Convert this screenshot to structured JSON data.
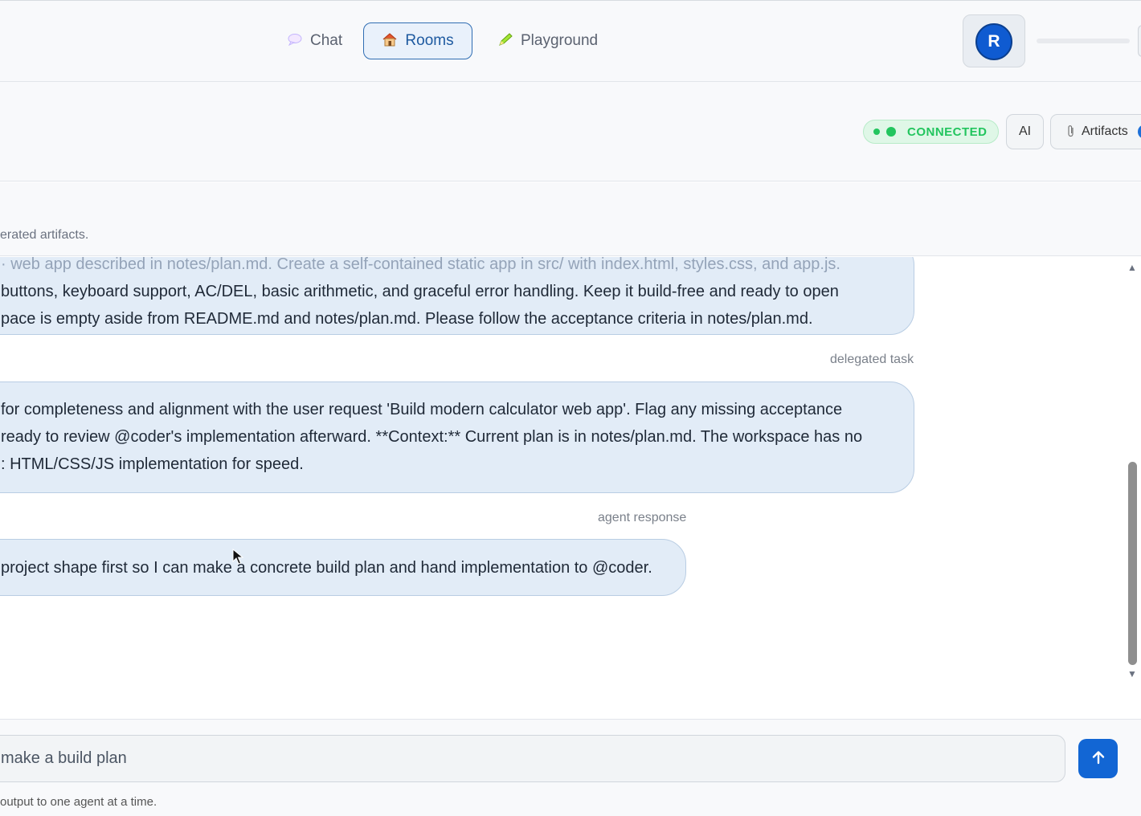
{
  "nav": {
    "tabs": [
      {
        "label": "Chat",
        "icon": "speech-bubble-icon",
        "active": false
      },
      {
        "label": "Rooms",
        "icon": "house-icon",
        "active": true
      },
      {
        "label": "Playground",
        "icon": "pencil-icon",
        "active": false
      }
    ],
    "avatar_initial": "R"
  },
  "room_header": {
    "status": "CONNECTED",
    "ai_label": "AI",
    "artifacts_label": "Artifacts"
  },
  "subbar": {
    "text": "erated artifacts."
  },
  "messages": [
    {
      "lines": [
        "· web app described in notes/plan.md. Create a self-contained static app in src/ with index.html, styles.css, and app.js.",
        "buttons, keyboard support, AC/DEL, basic arithmetic, and graceful error handling. Keep it build-free and ready to open",
        "pace is empty aside from README.md and notes/plan.md. Please follow the acceptance criteria in notes/plan.md."
      ],
      "meta": "delegated task"
    },
    {
      "lines": [
        "for completeness and alignment with the user request 'Build modern calculator web app'. Flag any missing acceptance",
        "ready to review @coder's implementation afterward. **Context:** Current plan is in notes/plan.md. The workspace has no",
        ": HTML/CSS/JS implementation for speed."
      ],
      "meta": "agent response"
    },
    {
      "lines": [
        "project shape first so I can make a concrete build plan and hand implementation to @coder."
      ]
    }
  ],
  "composer": {
    "value": "make a build plan",
    "send_icon": "arrow-up-icon",
    "footer": "output to one agent at a time."
  }
}
